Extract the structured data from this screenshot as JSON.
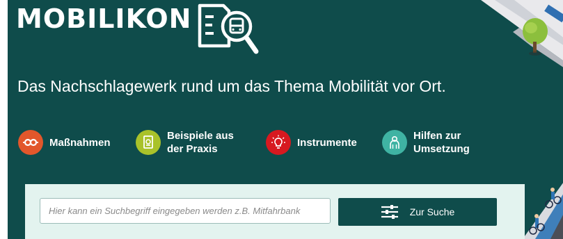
{
  "header": {
    "logo_text": "MOBILIKON",
    "logo_icon": "document-search-bus-icon",
    "tagline": "Das Nachschlagewerk rund um das Thema Mobilität vor Ort."
  },
  "nav": {
    "items": [
      {
        "label": "Maßnahmen",
        "icon": "gear-icon",
        "color": "#e2572b"
      },
      {
        "label": "Beispiele aus\nder Praxis",
        "icon": "document-icon",
        "color": "#a9c22a"
      },
      {
        "label": "Instrumente",
        "icon": "lightbulb-icon",
        "color": "#d71920"
      },
      {
        "label": "Hilfen zur\nUmsetzung",
        "icon": "helper-icon",
        "color": "#3fb3a3"
      }
    ]
  },
  "search": {
    "placeholder": "Hier kann ein Suchbegriff eingegeben werden z.B. Mitfahrbank",
    "value": "",
    "button_label": "Zur Suche",
    "button_icon": "filter-sliders-icon"
  },
  "colors": {
    "hero_background": "#0f4c4b",
    "search_panel": "#e3f3ef",
    "button": "#0f4c4b"
  }
}
